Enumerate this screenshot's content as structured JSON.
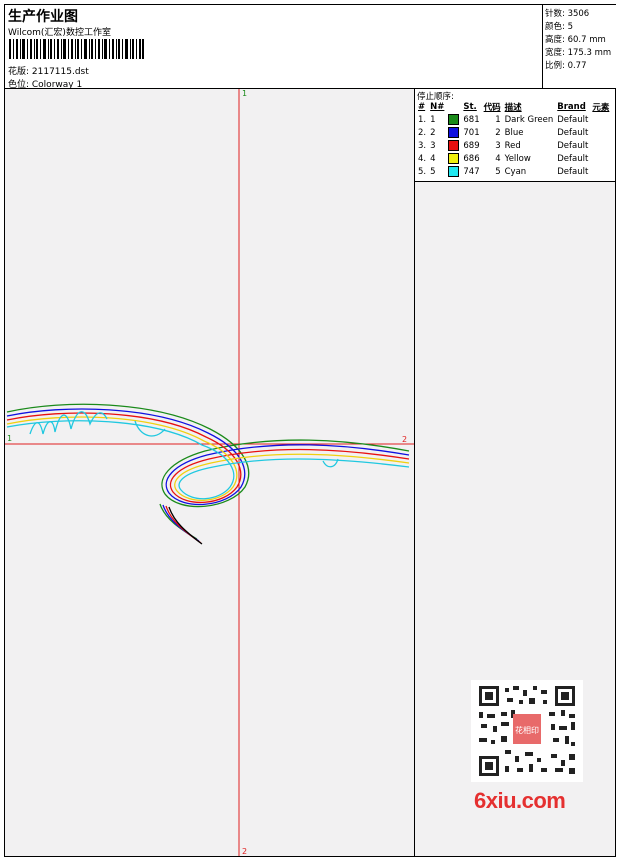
{
  "header": {
    "title": "生产作业图",
    "subtitle": "Wilcom(汇宏)数控工作室",
    "file_label": "花版: 2117115.dst",
    "colorway_label": "色位: Colorway 1"
  },
  "stats": {
    "stitches": "针数: 3506",
    "colors": "颜色: 5",
    "height": "高度: 60.7 mm",
    "width": "宽度: 175.3 mm",
    "scale": "比例: 0.77"
  },
  "stop_sequence": {
    "label": "停止顺序:",
    "headers": [
      "#",
      "N#",
      "St.",
      "代码",
      "描述",
      "Brand",
      "元素"
    ],
    "rows": [
      {
        "idx": "1.",
        "n": "1",
        "color": "#1a8a1a",
        "st": "681",
        "code": "1",
        "desc": "Dark Green",
        "brand": "Default"
      },
      {
        "idx": "2.",
        "n": "2",
        "color": "#1010e0",
        "st": "701",
        "code": "2",
        "desc": "Blue",
        "brand": "Default"
      },
      {
        "idx": "3.",
        "n": "3",
        "color": "#e81010",
        "st": "689",
        "code": "3",
        "desc": "Red",
        "brand": "Default"
      },
      {
        "idx": "4.",
        "n": "4",
        "color": "#f0f010",
        "st": "686",
        "code": "4",
        "desc": "Yellow",
        "brand": "Default"
      },
      {
        "idx": "5.",
        "n": "5",
        "color": "#20e8f0",
        "st": "747",
        "code": "5",
        "desc": "Cyan",
        "brand": "Default"
      }
    ]
  },
  "axis_labels": {
    "top": "1",
    "left": "1",
    "right": "2",
    "bottom": "2"
  },
  "watermark": "6xiu.com",
  "qr_stamp": "花相印"
}
